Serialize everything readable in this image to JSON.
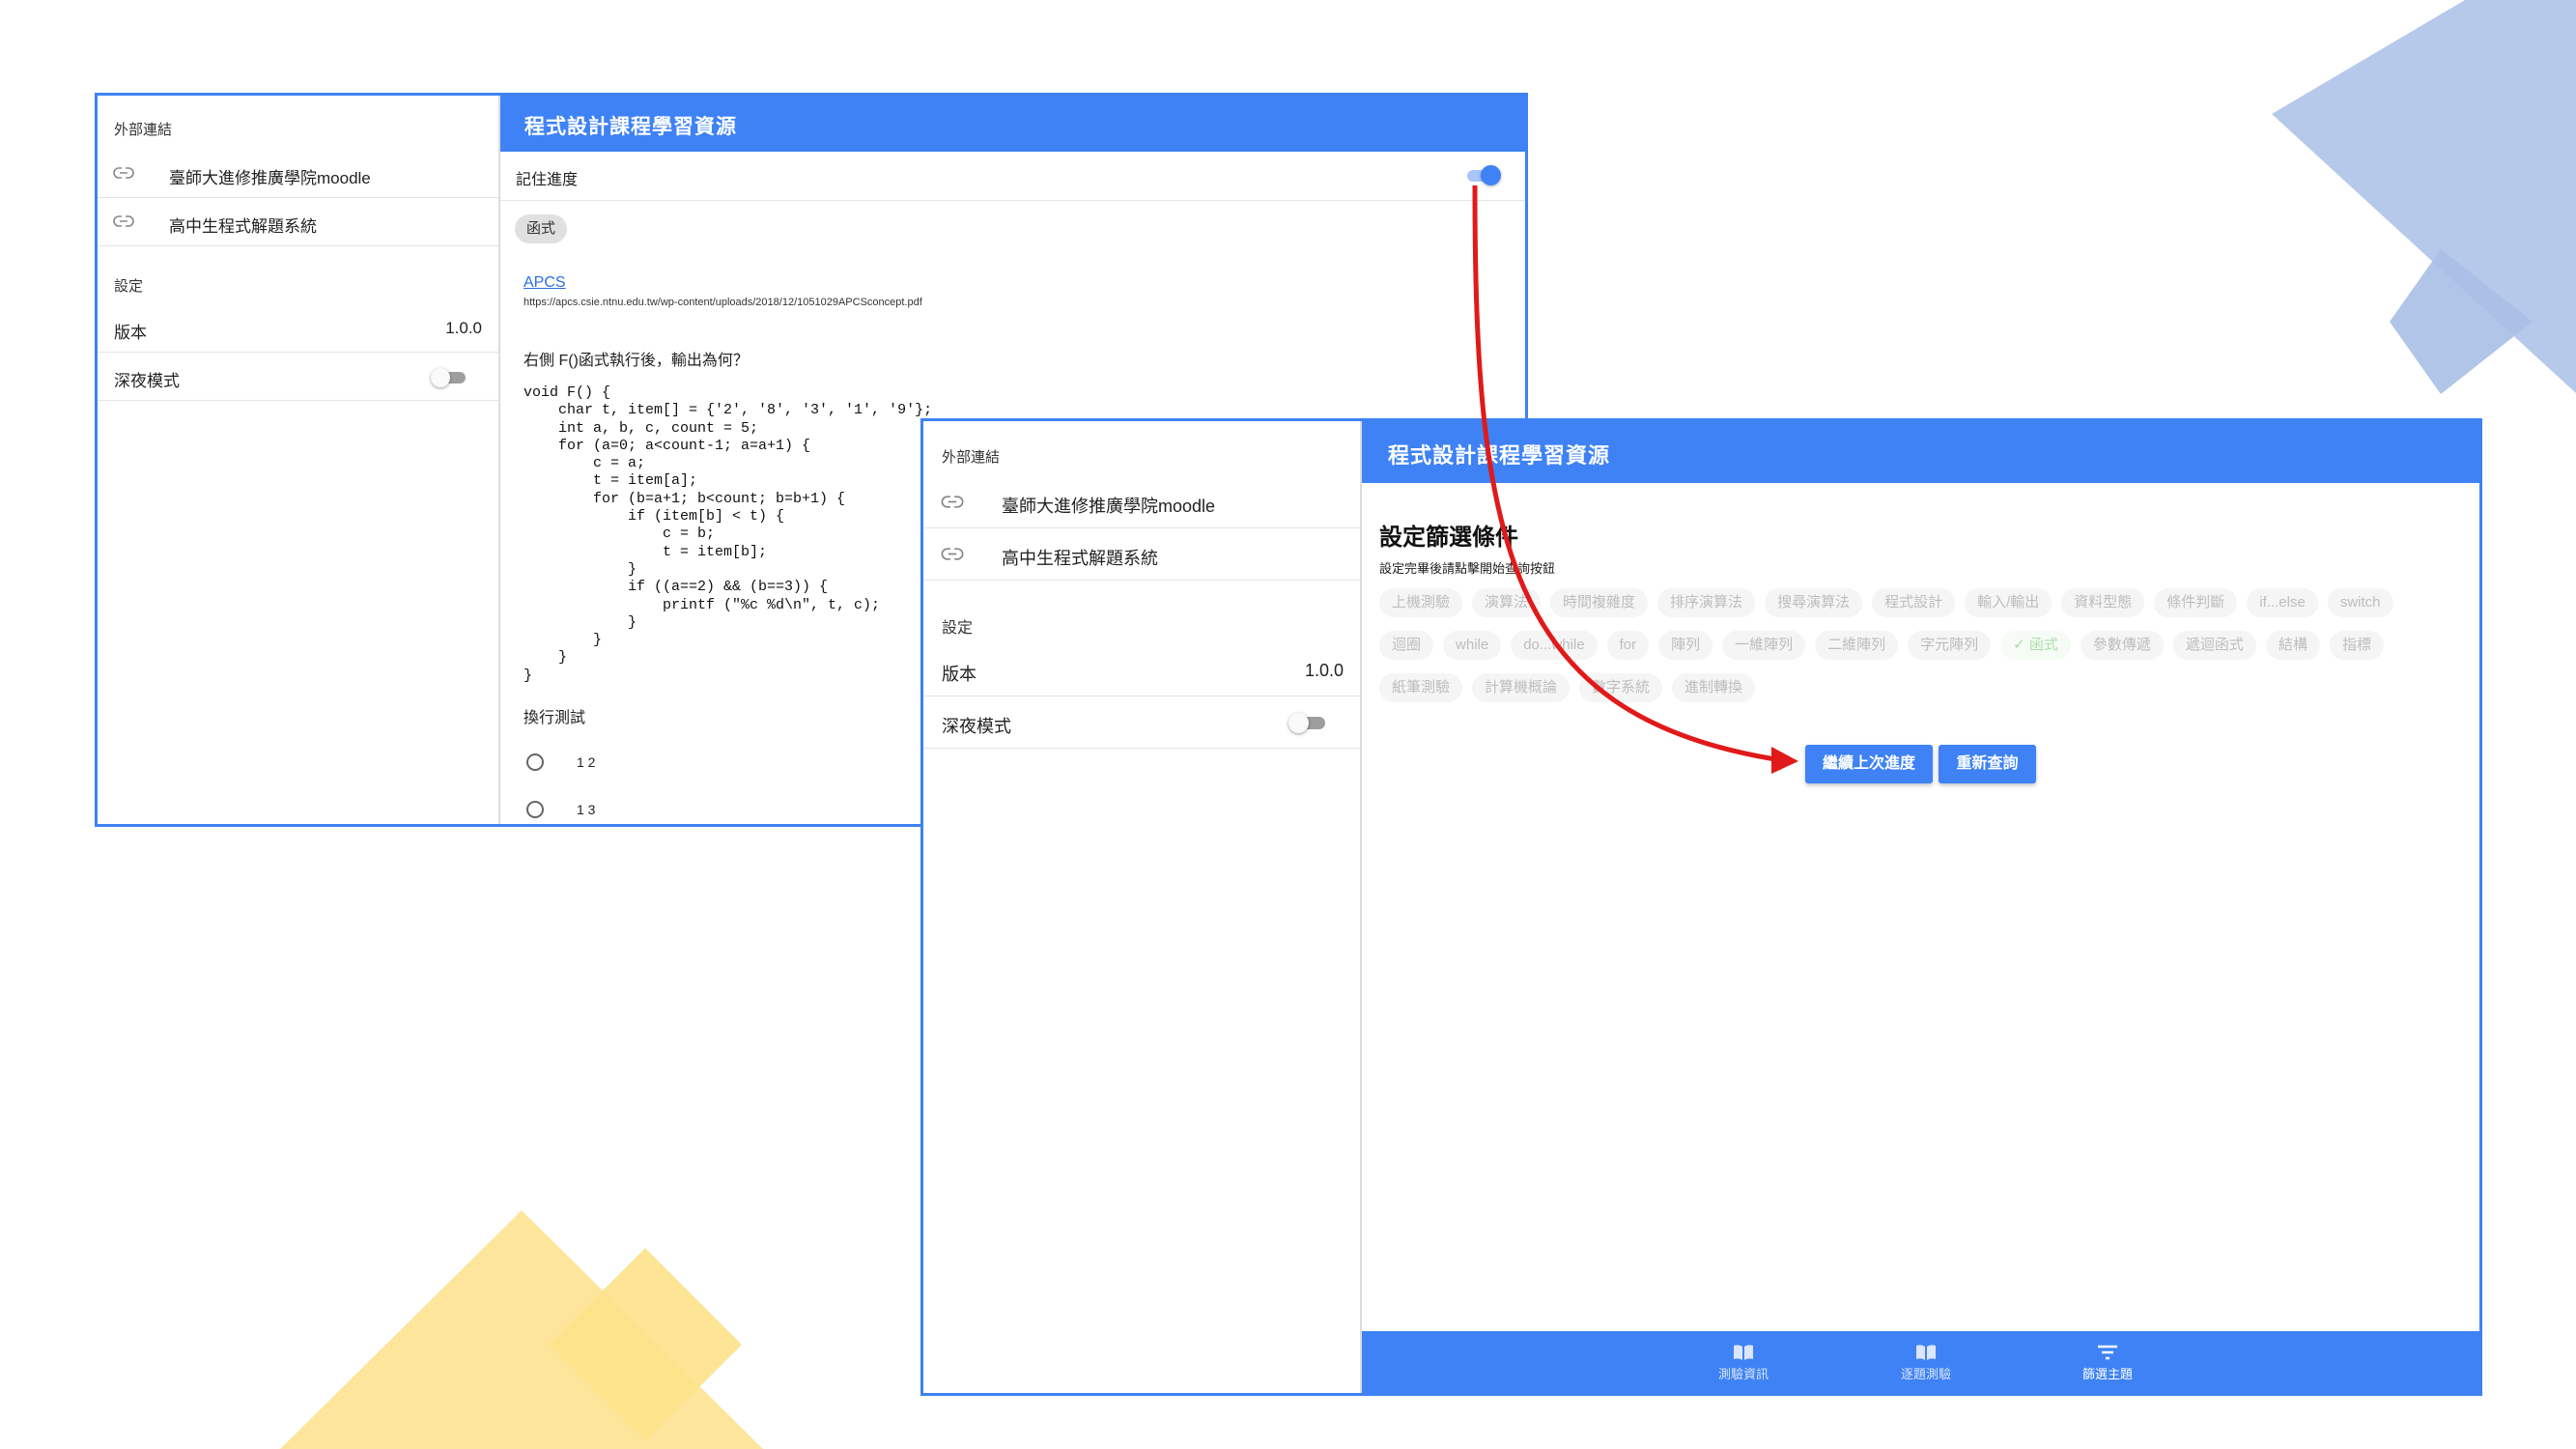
{
  "colors": {
    "primary": "#3e82f5",
    "deco_blue": "#a9bfe6",
    "deco_yellow": "#fde28a",
    "arrow": "#e01a1a"
  },
  "sidebar": {
    "external_links_title": "外部連結",
    "links": [
      {
        "label": "臺師大進修推廣學院moodle",
        "icon": "link-icon"
      },
      {
        "label": "高中生程式解題系統",
        "icon": "link-icon"
      }
    ],
    "settings_title": "設定",
    "version_label": "版本",
    "version_value": "1.0.0",
    "dark_mode_label": "深夜模式"
  },
  "app": {
    "title": "程式設計課程學習資源"
  },
  "quiz": {
    "remember_progress_label": "記住進度",
    "topic_chip": "函式",
    "source_link": "APCS",
    "source_url": "https://apcs.csie.ntnu.edu.tw/wp-content/uploads/2018/12/1051029APCSconcept.pdf",
    "question": "右側 F()函式執行後，輸出為何？",
    "code": "void F() {\n    char t, item[] = {'2', '8', '3', '1', '9'};\n    int a, b, c, count = 5;\n    for (a=0; a<count-1; a=a+1) {\n        c = a;\n        t = item[a];\n        for (b=a+1; b<count; b=b+1) {\n            if (item[b] < t) {\n                c = b;\n                t = item[b];\n            }\n            if ((a==2) && (b==3)) {\n                printf (\"%c %d\\n\", t, c);\n            }\n        }\n    }\n}",
    "line_break_test": "換行測試",
    "options": [
      "1 2",
      "1 3"
    ]
  },
  "filter": {
    "heading": "設定篩選條件",
    "hint": "設定完畢後請點擊開始查詢按鈕",
    "chips": [
      [
        "上機測驗",
        "演算法",
        "時間複雜度",
        "排序演算法",
        "搜尋演算法",
        "程式設計",
        "輸入/輸出",
        "資料型態",
        "條件判斷",
        "if...else",
        "switch"
      ],
      [
        "迴圈",
        "while",
        "do...while",
        "for",
        "陣列",
        "一維陣列",
        "二維陣列",
        "字元陣列",
        "函式",
        "參數傳遞",
        "遞迴函式",
        "結構",
        "指標"
      ],
      [
        "紙筆測驗",
        "計算機概論",
        "數字系統",
        "進制轉換"
      ]
    ],
    "selected_chip": "函式",
    "continue_button": "繼續上次進度",
    "requery_button": "重新查詢"
  },
  "bottom_nav": [
    {
      "label": "測驗資訊",
      "icon": "book-icon"
    },
    {
      "label": "逐題測驗",
      "icon": "book-icon"
    },
    {
      "label": "篩選主題",
      "icon": "filter-icon"
    }
  ]
}
